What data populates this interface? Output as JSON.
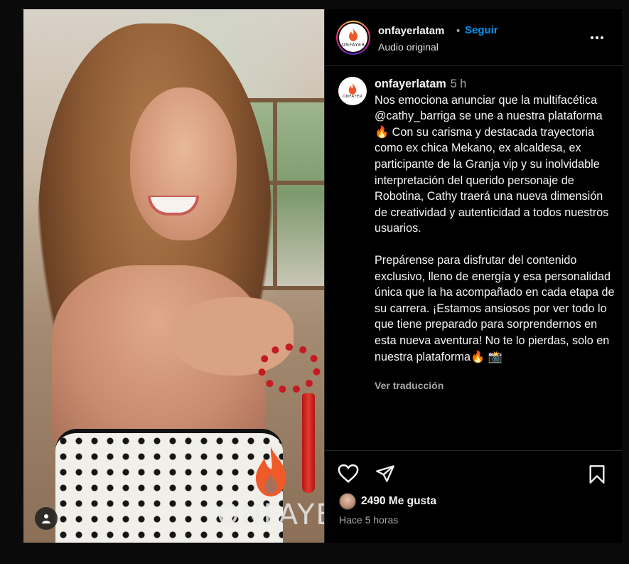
{
  "post": {
    "watermark": "ONFAYER"
  },
  "header": {
    "username": "onfayerlatam",
    "separator": "•",
    "follow_label": "Seguir",
    "audio_label": "Audio original",
    "logo_text": "ONFAYER"
  },
  "caption": {
    "username": "onfayerlatam",
    "time": "5 h",
    "paragraph1": "Nos emociona anunciar que la multifacética @cathy_barriga se une a nuestra plataforma 🔥 Con su carisma y destacada trayectoria como ex chica Mekano, ex alcaldesa, ex participante de la Granja vip y su inolvidable interpretación del querido personaje de Robotina, Cathy traerá una nueva dimensión de creatividad y autenticidad a todos nuestros usuarios.",
    "paragraph2": "Prepárense para disfrutar del contenido exclusivo, lleno de energía y esa personalidad única que la ha acompañado en cada etapa de su carrera. ¡Estamos ansiosos por ver todo lo que tiene preparado para sorprendernos en esta nueva aventura! No te lo pierdas, solo en nuestra plataforma🔥 📸",
    "see_translation": "Ver traducción"
  },
  "footer": {
    "likes": "2490 Me gusta",
    "time_ago": "Hace 5 horas"
  },
  "icons": {
    "like": "heart-icon",
    "share": "send-icon",
    "save": "bookmark-icon",
    "more": "more-options-icon",
    "user_tag": "person-icon"
  },
  "colors": {
    "follow": "#0095f6",
    "background": "#000000",
    "brand_flame": "#f05a28"
  }
}
